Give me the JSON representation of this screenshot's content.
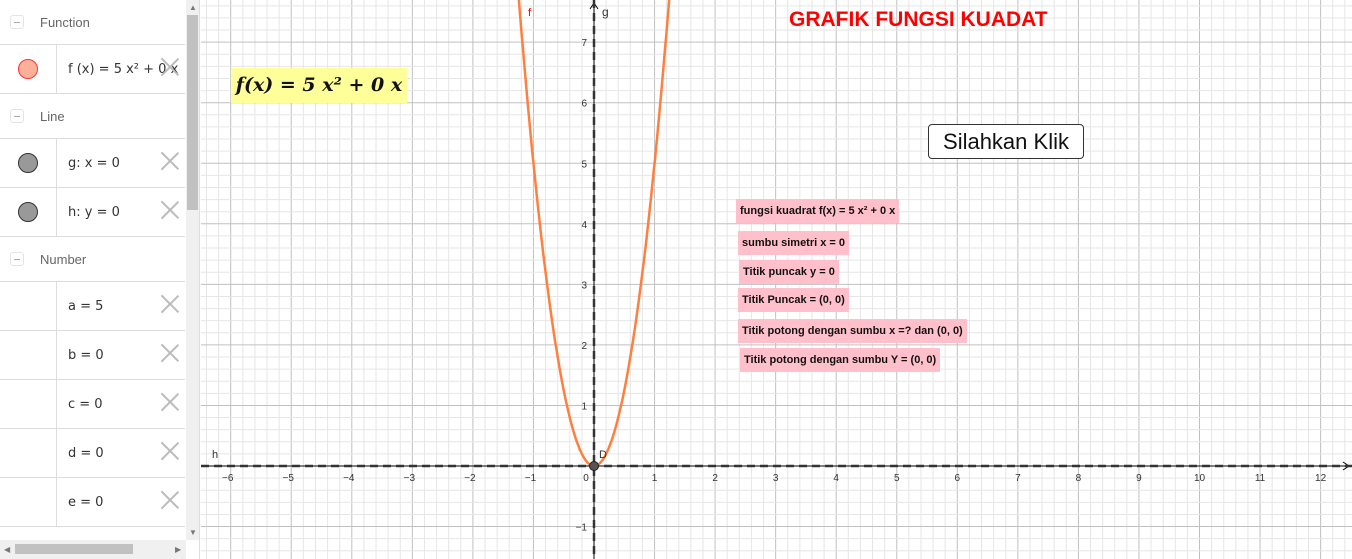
{
  "algebra": {
    "groups": [
      {
        "label": "Function",
        "items": [
          {
            "text": "f (x)  =  5 x² + 0 x",
            "color": "#fbb09a"
          }
        ]
      },
      {
        "label": "Line",
        "items": [
          {
            "text": "g: x = 0",
            "color": "#999999"
          },
          {
            "text": "h: y = 0",
            "color": "#999999"
          }
        ]
      },
      {
        "label": "Number",
        "items": [
          {
            "text": "a = 5"
          },
          {
            "text": "b = 0"
          },
          {
            "text": "c = 0"
          },
          {
            "text": "d = 0"
          },
          {
            "text": "e = 0"
          }
        ]
      }
    ]
  },
  "graphics": {
    "title": "GRAFIK FUNGSI KUADAT",
    "button": "Silahkan Klik",
    "formula": "f(x) = 5 x² + 0 x",
    "curve_label": "f",
    "yaxis_label": "g",
    "xaxis_label": "h",
    "point_label": "D",
    "curve_color": "#ff7f3f",
    "title_color": "#ff0000",
    "label_bg": "#ffc0cb",
    "function": {
      "a": 5,
      "b": 0,
      "c": 0
    },
    "xlim": [
      -6.5,
      12.5
    ],
    "ylim": [
      -1.5,
      7.7
    ],
    "x_ticks": [
      -6,
      -5,
      -4,
      -3,
      -2,
      -1,
      0,
      1,
      2,
      3,
      4,
      5,
      6,
      7,
      8,
      9,
      10,
      11,
      12
    ],
    "y_ticks": [
      -1,
      1,
      2,
      3,
      4,
      5,
      6,
      7
    ],
    "info_labels": [
      "fungsi kuadrat f(x) = 5 x² + 0 x",
      "sumbu simetri x = 0",
      "Titik puncak y = 0",
      "Titik Puncak = (0, 0)",
      "Titik potong dengan sumbu x =? dan (0, 0)",
      "Titik potong dengan sumbu Y = (0, 0)"
    ]
  }
}
